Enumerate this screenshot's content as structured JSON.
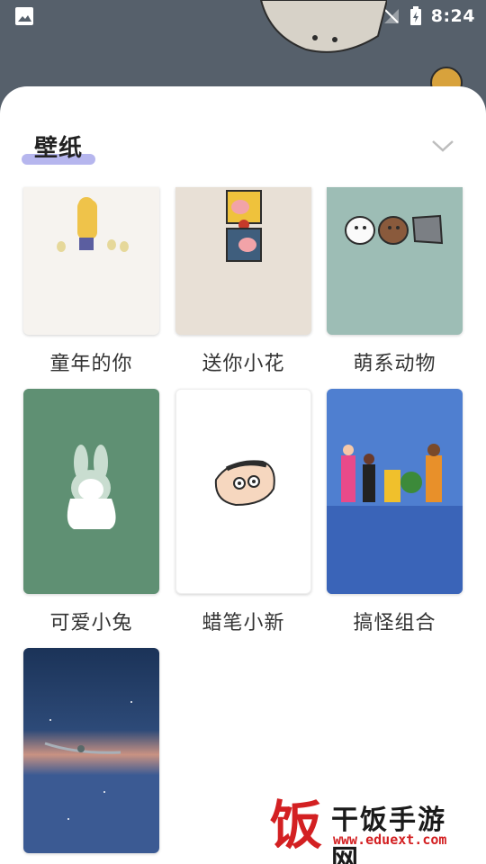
{
  "status_bar": {
    "time": "8:24"
  },
  "sheet": {
    "title": "壁纸"
  },
  "wallpapers": [
    {
      "label": "童年的你",
      "bg": "#f6f3ef"
    },
    {
      "label": "送你小花",
      "bg": "#e8e0d6"
    },
    {
      "label": "萌系动物",
      "bg": "#9dbdb5"
    },
    {
      "label": "可爱小兔",
      "bg": "#5f9073"
    },
    {
      "label": "蜡笔小新",
      "bg": "#ffffff"
    },
    {
      "label": "搞怪组合",
      "bg": "#4f7fd0"
    },
    {
      "label": "",
      "bg": "#2d4a78"
    }
  ],
  "watermark": {
    "logo_char": "饭",
    "name": "干饭手游网",
    "url": "www.eduext.com"
  },
  "colors": {
    "sheet_bg": "#ffffff",
    "title_underline": "#b6b6ee",
    "backdrop": "#56606b"
  }
}
